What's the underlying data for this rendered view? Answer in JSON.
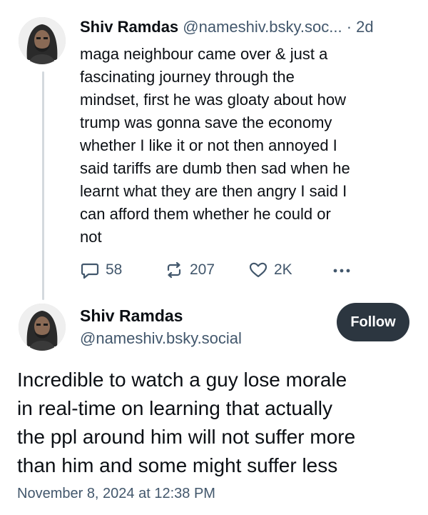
{
  "reply_post": {
    "author_name": "Shiv Ramdas",
    "author_handle": "@nameshiv.bsky.soc...",
    "separator": "·",
    "time_ago": "2d",
    "text": "maga neighbour came over & just a\nfascinating journey through the\nmindset,  first he was gloaty about how\ntrump was gonna save the economy\nwhether I like it or not  then annoyed I\nsaid tariffs are dumb then sad when he\nlearnt what they are then angry I said I\ncan afford them whether he could or\nnot",
    "actions": {
      "reply_count": "58",
      "repost_count": "207",
      "like_count": "2K"
    }
  },
  "main_post": {
    "author_name": "Shiv Ramdas",
    "author_handle": "@nameshiv.bsky.social",
    "follow_label": "Follow",
    "text": "Incredible to watch a guy lose morale\nin real-time on learning that actually\nthe ppl around him will not suffer more\nthan him and some might suffer less",
    "timestamp": "November 8, 2024 at 12:38 PM"
  },
  "icons": {
    "reply": "speech-bubble-icon",
    "repost": "repost-arrows-icon",
    "like": "heart-icon",
    "more": "ellipsis-icon"
  },
  "colors": {
    "text_primary": "#0b0f14",
    "text_secondary": "#42576c",
    "thread_line": "#d4d9de",
    "follow_bg": "#2c3640",
    "follow_text": "#ffffff"
  }
}
